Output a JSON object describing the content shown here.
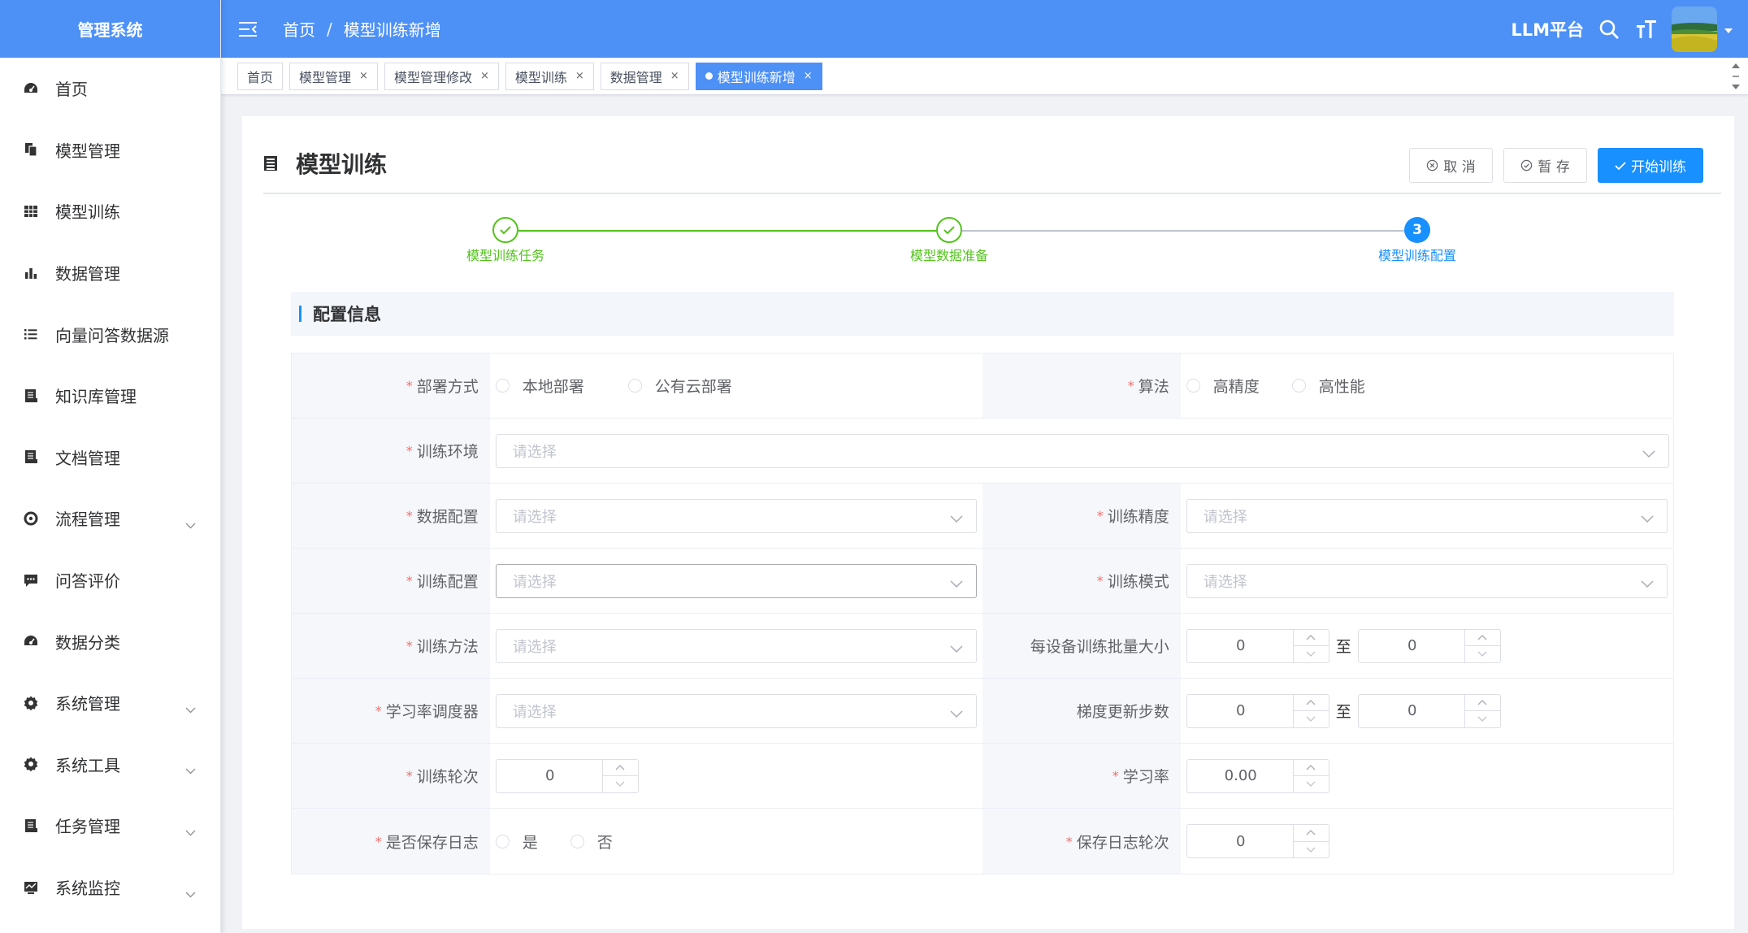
{
  "app": {
    "logo_text": "管理系统",
    "platform_label": "LLM平台",
    "accent_color": "#4d91f7",
    "primary_color": "#1890ff",
    "success_color": "#52c41a"
  },
  "breadcrumb": [
    "首页",
    "模型训练新增"
  ],
  "sidebar": {
    "items": [
      {
        "label": "首页",
        "icon": "dashboard-icon",
        "has_children": false
      },
      {
        "label": "模型管理",
        "icon": "files-icon",
        "has_children": false
      },
      {
        "label": "模型训练",
        "icon": "grid-icon",
        "has_children": false
      },
      {
        "label": "数据管理",
        "icon": "bar-chart-icon",
        "has_children": false
      },
      {
        "label": "向量问答数据源",
        "icon": "list-icon",
        "has_children": false
      },
      {
        "label": "知识库管理",
        "icon": "book-icon",
        "has_children": false
      },
      {
        "label": "文档管理",
        "icon": "document-icon",
        "has_children": false
      },
      {
        "label": "流程管理",
        "icon": "flow-icon",
        "has_children": true
      },
      {
        "label": "问答评价",
        "icon": "chat-icon",
        "has_children": false
      },
      {
        "label": "数据分类",
        "icon": "dashboard-icon",
        "has_children": false
      },
      {
        "label": "系统管理",
        "icon": "gear-icon",
        "has_children": true
      },
      {
        "label": "系统工具",
        "icon": "gear-icon",
        "has_children": true
      },
      {
        "label": "任务管理",
        "icon": "book-icon",
        "has_children": true
      },
      {
        "label": "系统监控",
        "icon": "monitor-icon",
        "has_children": true
      }
    ]
  },
  "tags": [
    {
      "label": "首页",
      "closable": false,
      "active": false
    },
    {
      "label": "模型管理",
      "closable": true,
      "active": false
    },
    {
      "label": "模型管理修改",
      "closable": true,
      "active": false
    },
    {
      "label": "模型训练",
      "closable": true,
      "active": false
    },
    {
      "label": "数据管理",
      "closable": true,
      "active": false
    },
    {
      "label": "模型训练新增",
      "closable": true,
      "active": true
    }
  ],
  "page": {
    "title": "模型训练",
    "buttons": {
      "cancel": "取 消",
      "save_draft": "暂 存",
      "start": "开始训练"
    }
  },
  "steps": [
    {
      "label": "模型训练任务",
      "status": "finished"
    },
    {
      "label": "模型数据准备",
      "status": "finished"
    },
    {
      "label": "模型训练配置",
      "status": "current",
      "number": "3"
    }
  ],
  "section": {
    "title": "配置信息"
  },
  "form": {
    "select_placeholder": "请选择",
    "range_separator": "至",
    "deploy_mode": {
      "label": "部署方式",
      "required": true,
      "options": [
        "本地部署",
        "公有云部署"
      ]
    },
    "algorithm": {
      "label": "算法",
      "required": true,
      "options": [
        "高精度",
        "高性能"
      ]
    },
    "train_env": {
      "label": "训练环境",
      "required": true
    },
    "data_config": {
      "label": "数据配置",
      "required": true
    },
    "train_precision": {
      "label": "训练精度",
      "required": true
    },
    "train_config": {
      "label": "训练配置",
      "required": true
    },
    "train_mode": {
      "label": "训练模式",
      "required": true
    },
    "train_method": {
      "label": "训练方法",
      "required": true
    },
    "batch_size": {
      "label": "每设备训练批量大小",
      "required": false,
      "from": "0",
      "to": "0"
    },
    "lr_scheduler": {
      "label": "学习率调度器",
      "required": true
    },
    "grad_steps": {
      "label": "梯度更新步数",
      "required": false,
      "from": "0",
      "to": "0"
    },
    "epochs": {
      "label": "训练轮次",
      "required": true,
      "value": "0"
    },
    "learning_rate": {
      "label": "学习率",
      "required": true,
      "value": "0.00"
    },
    "save_log": {
      "label": "是否保存日志",
      "required": true,
      "options": [
        "是",
        "否"
      ]
    },
    "save_log_epochs": {
      "label": "保存日志轮次",
      "required": true,
      "value": "0"
    }
  }
}
